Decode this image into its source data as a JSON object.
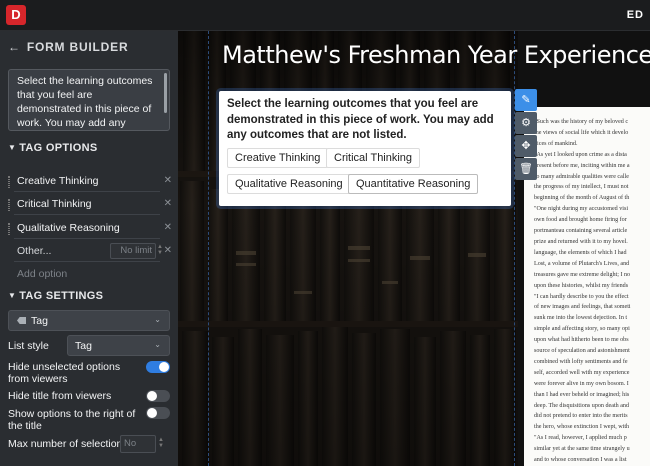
{
  "app": {
    "logo_letter": "D",
    "topright_text": "ED"
  },
  "sidebar": {
    "heading": "FORM BUILDER",
    "back_arrow": "←",
    "prompt_text": "Select the learning outcomes that you feel are demonstrated in this piece of work. You may add any outcomes that are not listed.",
    "tag_options": {
      "title": "TAG OPTIONS",
      "options": [
        {
          "label": "Creative Thinking"
        },
        {
          "label": "Critical Thinking"
        },
        {
          "label": "Qualitative Reasoning"
        }
      ],
      "other_label": "Other...",
      "other_placeholder": "No limit",
      "add_option": "Add option"
    },
    "tag_settings": {
      "title": "TAG SETTINGS",
      "type_value": "Tag",
      "list_style_label": "List style",
      "list_style_value": "Tag",
      "toggles": [
        {
          "label": "Hide unselected options from viewers",
          "on": true
        },
        {
          "label": "Hide title from viewers",
          "on": false
        },
        {
          "label": "Show options to the right of the title",
          "on": false
        }
      ],
      "max_selection_label": "Max number of selection",
      "max_selection_placeholder": "No limit"
    }
  },
  "main": {
    "title": "Matthew's Freshman Year Experience",
    "widget": {
      "question": "Select the learning outcomes that you feel are demonstrated in this piece of work. You may add any outcomes that are not listed.",
      "chips": [
        "Creative Thinking",
        "Critical Thinking",
        "Qualitative Reasoning",
        "Quantitative Reasoning"
      ]
    },
    "tools": [
      "edit-icon",
      "gear-icon",
      "move-icon",
      "trash-icon"
    ],
    "paper_lines": [
      "\"Such was the history of my beloved c",
      "the views of social life which it develo",
      "vices of mankind.",
      "\"As yet I looked upon crime as a dista",
      "present before me, inciting within me a",
      "so many admirable qualities were calle",
      "the progress of my intellect, I must not",
      "beginning of the month of August of th",
      "\"One night during my accustomed visi",
      "own food and brought home firing for",
      "portmanteau containing several article",
      "prize and returned with it to my hovel.",
      "language, the elements of which I had",
      "Lost, a volume of Plutarch's Lives, and",
      "treasures gave me extreme delight; I no",
      "upon these histories, whilst my friends",
      "\"I can hardly describe to you the effect",
      "of new images and feelings, that someti",
      "sunk me into the lowest dejection. In t",
      "simple and affecting story, so many opi",
      "upon what had hitherto been to me obs",
      "source of speculation and astonishment",
      "combined with lofty sentiments and fe",
      "self, accorded well with my experience",
      "were forever alive in my own bosom. I",
      "than I had ever beheld or imagined; his",
      "deep. The disquisitions upon death and",
      "did not pretend to enter into the merits",
      "the hero, whose extinction I wept, with",
      "\"As I read, however, I applied much p",
      "similar yet at the same time strangely u",
      "and to whose conversation I was a list"
    ]
  },
  "colors": {
    "accent": "#2f7de1",
    "logo_red": "#d6262b",
    "sidebar_bg": "#2a2d31"
  }
}
